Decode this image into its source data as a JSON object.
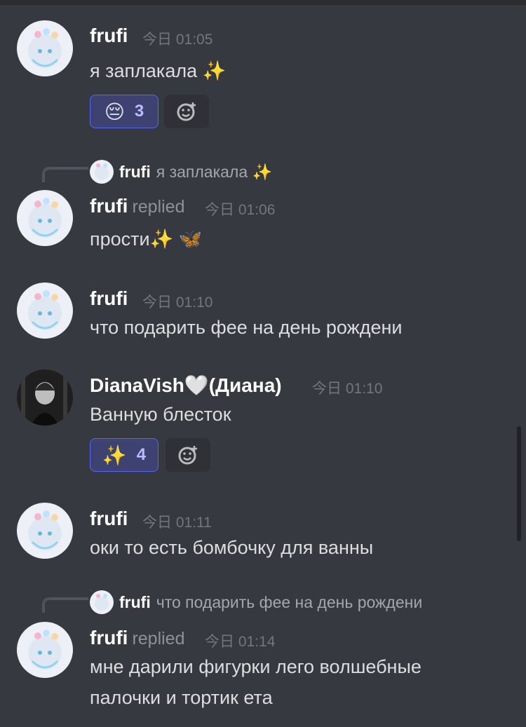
{
  "messages": [
    {
      "author": "frufi",
      "time": "今日 01:05",
      "text": "я заплакала ✨",
      "reaction": {
        "emoji": "😔",
        "count": "3"
      }
    },
    {
      "reply_to": {
        "author": "frufi",
        "text": "я заплакала ✨"
      },
      "author": "frufi",
      "replied_label": "replied",
      "time": "今日 01:06",
      "text": "прости✨ 🦋"
    },
    {
      "author": "frufi",
      "time": "今日 01:10",
      "text": "что подарить фее на день рождени"
    },
    {
      "author": "DianaVish🤍(Диана)",
      "time": "今日 01:10",
      "text": "Ванную блесток",
      "reaction": {
        "emoji": "✨",
        "count": "4"
      }
    },
    {
      "author": "frufi",
      "time": "今日 01:11",
      "text": "оки то есть бомбочку для ванны"
    },
    {
      "reply_to": {
        "author": "frufi",
        "text": "что подарить фее на день рождени"
      },
      "author": "frufi",
      "replied_label": "replied",
      "time": "今日 01:14",
      "text_lines": [
        "мне дарили фигурки лего волшебные",
        "палочки и  тортик ета"
      ]
    }
  ],
  "colors": {
    "background": "#36393f",
    "accent": "#5865f2",
    "muted": "#72767d"
  },
  "icons": {
    "add_reaction": "add-reaction-icon",
    "avatar": "avatar"
  }
}
